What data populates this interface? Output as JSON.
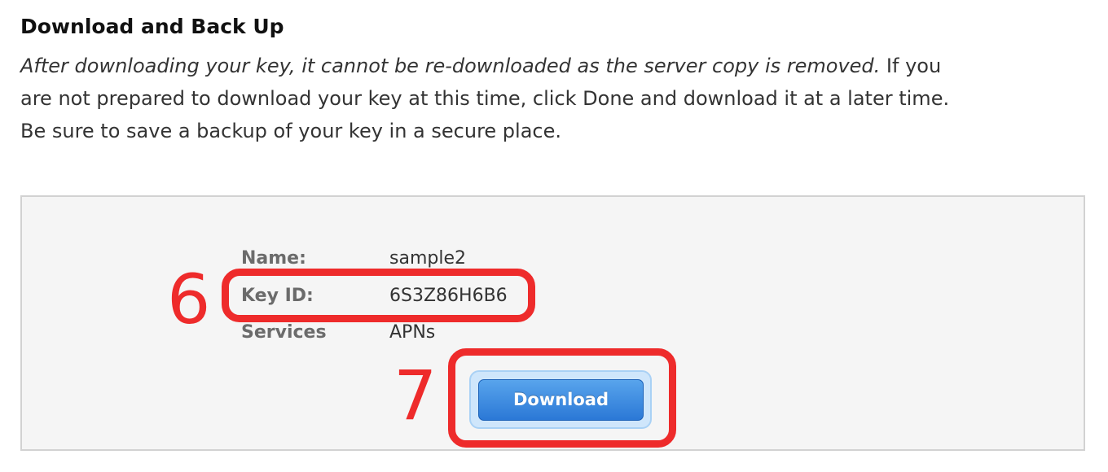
{
  "section": {
    "heading": "Download and Back Up",
    "paragraph_italic": "After downloading your key, it cannot be re-downloaded as the server copy is removed.",
    "paragraph_line1_rest": " If you",
    "paragraph_line2": "are not prepared to download your key at this time, click Done and download it at a later time.",
    "paragraph_line3": "Be sure to save a backup of your key in a secure place."
  },
  "key_details": {
    "rows": [
      {
        "label": "Name:",
        "value": "sample2"
      },
      {
        "label": "Key ID:",
        "value": "6S3Z86H6B6"
      },
      {
        "label": "Services",
        "value": "APNs"
      }
    ]
  },
  "actions": {
    "download_label": "Download"
  },
  "annotations": {
    "step_6": "6",
    "step_7": "7",
    "color": "#ee2b2b"
  },
  "colors": {
    "button_primary": "#2b78d6",
    "panel_background": "#f5f5f5",
    "panel_border": "#d2d2d2"
  }
}
